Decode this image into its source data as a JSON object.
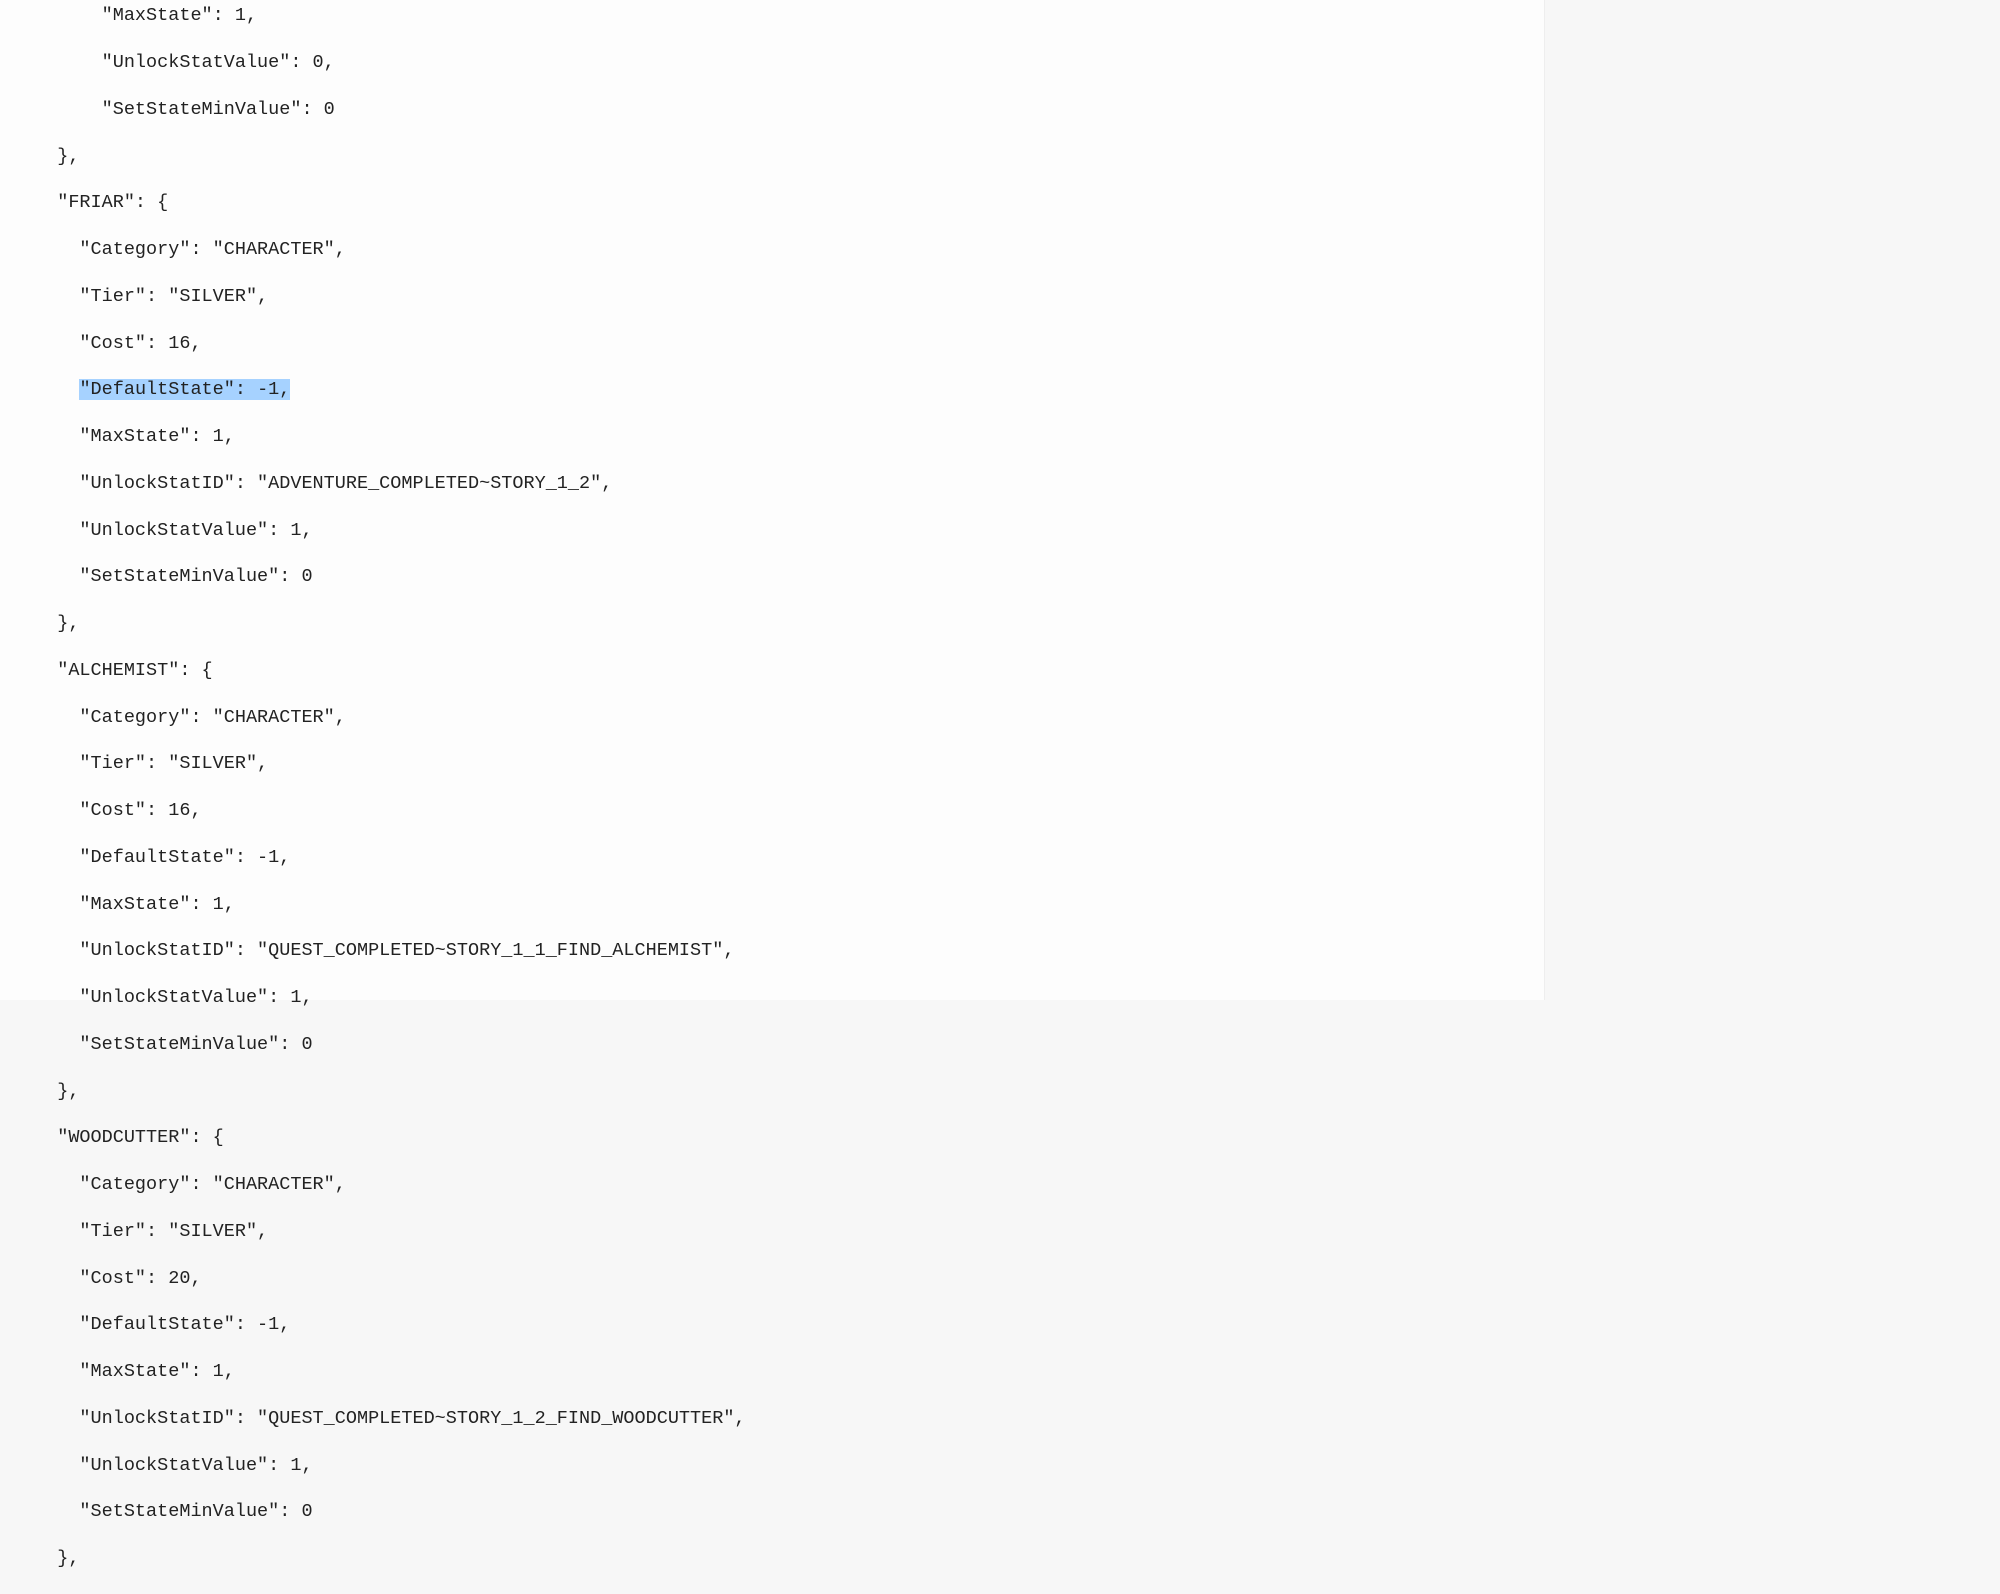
{
  "code": {
    "indent1": "  ",
    "indent2": "    ",
    "partial_top": {
      "line1": "  \"MaxState\": 1,",
      "line2": "  \"UnlockStatValue\": 0,",
      "line3": "  \"SetStateMinValue\": 0",
      "line4": "},"
    },
    "friar": {
      "key": "\"FRIAR\": {",
      "category": "  \"Category\": \"CHARACTER\",",
      "tier": "  \"Tier\": \"SILVER\",",
      "cost": "  \"Cost\": 16,",
      "defaultstate_pre": "  ",
      "defaultstate_sel": "\"DefaultState\": -1,",
      "maxstate": "  \"MaxState\": 1,",
      "unlockstatid": "  \"UnlockStatID\": \"ADVENTURE_COMPLETED~STORY_1_2\",",
      "unlockstatvalue": "  \"UnlockStatValue\": 1,",
      "setstateminvalue": "  \"SetStateMinValue\": 0",
      "close": "},"
    },
    "alchemist": {
      "key": "\"ALCHEMIST\": {",
      "category": "  \"Category\": \"CHARACTER\",",
      "tier": "  \"Tier\": \"SILVER\",",
      "cost": "  \"Cost\": 16,",
      "defaultstate": "  \"DefaultState\": -1,",
      "maxstate": "  \"MaxState\": 1,",
      "unlockstatid": "  \"UnlockStatID\": \"QUEST_COMPLETED~STORY_1_1_FIND_ALCHEMIST\",",
      "unlockstatvalue": "  \"UnlockStatValue\": 1,",
      "setstateminvalue": "  \"SetStateMinValue\": 0",
      "close": "},"
    },
    "woodcutter": {
      "key": "\"WOODCUTTER\": {",
      "category": "  \"Category\": \"CHARACTER\",",
      "tier": "  \"Tier\": \"SILVER\",",
      "cost": "  \"Cost\": 20,",
      "defaultstate": "  \"DefaultState\": -1,",
      "maxstate": "  \"MaxState\": 1,",
      "unlockstatid": "  \"UnlockStatID\": \"QUEST_COMPLETED~STORY_1_2_FIND_WOODCUTTER\",",
      "unlockstatvalue": "  \"UnlockStatValue\": 1,",
      "setstateminvalue": "  \"SetStateMinValue\": 0",
      "close": "},"
    }
  }
}
